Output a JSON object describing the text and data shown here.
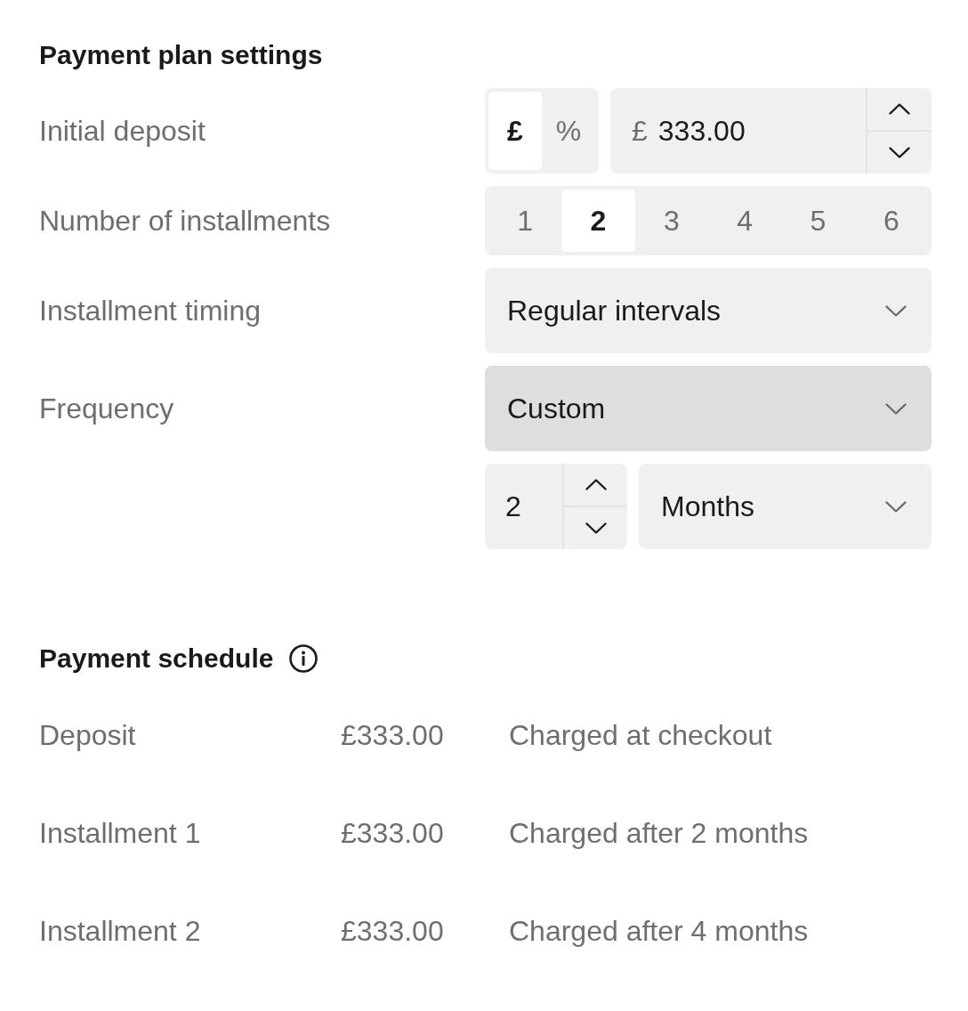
{
  "settings": {
    "title": "Payment plan settings",
    "rows": [
      {
        "kind": "deposit",
        "label": "Initial deposit",
        "units": [
          {
            "label": "£",
            "selected": true
          },
          {
            "label": "%",
            "selected": false
          }
        ],
        "prefix": "£",
        "value": "333.00"
      },
      {
        "kind": "segmented",
        "label": "Number of installments",
        "options": [
          {
            "label": "1",
            "selected": false
          },
          {
            "label": "2",
            "selected": true
          },
          {
            "label": "3",
            "selected": false
          },
          {
            "label": "4",
            "selected": false
          },
          {
            "label": "5",
            "selected": false
          },
          {
            "label": "6",
            "selected": false
          }
        ]
      },
      {
        "kind": "select",
        "label": "Installment timing",
        "value": "Regular intervals",
        "hovered": false
      },
      {
        "kind": "select",
        "label": "Frequency",
        "value": "Custom",
        "hovered": true
      },
      {
        "kind": "interval",
        "value": "2",
        "unit": "Months"
      }
    ]
  },
  "schedule": {
    "title": "Payment schedule",
    "rows": [
      {
        "label": "Deposit",
        "amount": "£333.00",
        "note": "Charged at checkout"
      },
      {
        "label": "Installment 1",
        "amount": "£333.00",
        "note": "Charged after 2 months"
      },
      {
        "label": "Installment 2",
        "amount": "£333.00",
        "note": "Charged after 4 months"
      }
    ]
  }
}
